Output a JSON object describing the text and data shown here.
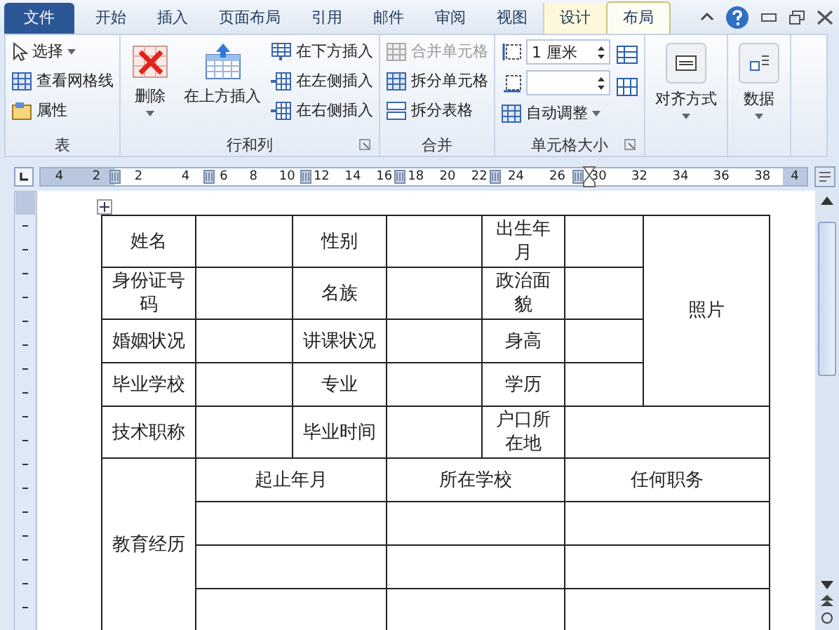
{
  "tabs": [
    {
      "label": "文件",
      "kind": "file",
      "selected": false
    },
    {
      "label": "开始",
      "kind": "normal",
      "selected": false
    },
    {
      "label": "插入",
      "kind": "normal",
      "selected": false
    },
    {
      "label": "页面布局",
      "kind": "normal",
      "selected": false
    },
    {
      "label": "引用",
      "kind": "normal",
      "selected": false
    },
    {
      "label": "邮件",
      "kind": "normal",
      "selected": false
    },
    {
      "label": "审阅",
      "kind": "normal",
      "selected": false
    },
    {
      "label": "视图",
      "kind": "normal",
      "selected": false
    },
    {
      "label": "设计",
      "kind": "context",
      "selected": false
    },
    {
      "label": "布局",
      "kind": "context",
      "selected": true
    }
  ],
  "ribbon": {
    "groups": [
      {
        "label": "表",
        "columns": [
          [
            {
              "kind": "small",
              "label": "选择",
              "dropdown": true,
              "disabled": false
            },
            {
              "kind": "small",
              "label": "查看网格线",
              "disabled": false
            },
            {
              "kind": "small",
              "label": "属性",
              "disabled": false
            }
          ]
        ]
      },
      {
        "label": "行和列",
        "launcher": true,
        "columns": [
          [
            {
              "kind": "large",
              "label": "删除",
              "dropdown": true,
              "disabled": false
            }
          ],
          [
            {
              "kind": "large",
              "label": "在上方插入",
              "disabled": false
            }
          ],
          [
            {
              "kind": "small",
              "label": "在下方插入",
              "disabled": false
            },
            {
              "kind": "small",
              "label": "在左侧插入",
              "disabled": false
            },
            {
              "kind": "small",
              "label": "在右侧插入",
              "disabled": false
            }
          ]
        ]
      },
      {
        "label": "合并",
        "columns": [
          [
            {
              "kind": "small",
              "label": "合并单元格",
              "disabled": true
            },
            {
              "kind": "small",
              "label": "拆分单元格",
              "disabled": false
            },
            {
              "kind": "small",
              "label": "拆分表格",
              "disabled": false
            }
          ]
        ]
      },
      {
        "label": "单元格大小",
        "launcher": true,
        "columns": [
          [
            {
              "kind": "spin",
              "value": "1 厘米"
            },
            {
              "kind": "spin"
            },
            {
              "kind": "small",
              "label": "自动调整",
              "dropdown": true,
              "disabled": false
            }
          ],
          [
            {
              "kind": "icon"
            },
            {
              "kind": "icon"
            }
          ]
        ]
      },
      {
        "columns": [
          [
            {
              "kind": "large",
              "label": "对齐方式",
              "dropdown": true,
              "disabled": false
            }
          ]
        ]
      },
      {
        "columns": [
          [
            {
              "kind": "large",
              "label": "数据",
              "dropdown": true,
              "disabled": false
            }
          ]
        ]
      }
    ]
  },
  "ruler": [
    [
      "4",
      "2"
    ],
    [
      "2",
      "4"
    ],
    [
      "6",
      "8",
      "10"
    ],
    [
      "12",
      "14",
      "16"
    ],
    [
      "18",
      "20",
      "22"
    ],
    [
      "24",
      "26"
    ],
    [
      "30",
      "32",
      "34",
      "36",
      "38"
    ],
    [
      "4"
    ]
  ],
  "table": {
    "rows": [
      [
        {
          "text": "姓名"
        },
        {},
        {
          "text": "性别"
        },
        {},
        {
          "text": "出生年月"
        },
        {},
        {
          "text": "照片",
          "rowspan": 4
        }
      ],
      [
        {
          "text": "身份证号码"
        },
        {},
        {
          "text": "名族"
        },
        {},
        {
          "text": "政治面貌"
        },
        {}
      ],
      [
        {
          "text": "婚姻状况"
        },
        {},
        {
          "text": "讲课状况"
        },
        {},
        {
          "text": "身高"
        },
        {}
      ],
      [
        {
          "text": "毕业学校"
        },
        {},
        {
          "text": "专业"
        },
        {},
        {
          "text": "学历"
        },
        {}
      ],
      [
        {
          "text": "技术职称"
        },
        {},
        {
          "text": "毕业时间"
        },
        {},
        {
          "text": "户口所在地"
        },
        {
          "colspan": 2
        }
      ],
      [
        {
          "text": "教育经历",
          "rowspan": 4
        },
        {
          "text": "起止年月",
          "colspan": 2
        },
        {
          "text": "所在学校",
          "colspan": 2
        },
        {
          "text": "任何职务",
          "colspan": 2
        }
      ],
      [
        {
          "colspan": 2
        },
        {
          "colspan": 2
        },
        {
          "colspan": 2
        }
      ],
      [
        {
          "colspan": 2
        },
        {
          "colspan": 2
        },
        {
          "colspan": 2
        }
      ],
      [
        {
          "colspan": 2
        },
        {
          "colspan": 2
        },
        {
          "colspan": 2
        }
      ]
    ]
  }
}
